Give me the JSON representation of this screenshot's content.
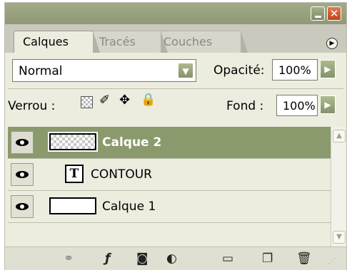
{
  "tabs": [
    {
      "label": "Calques",
      "active": true
    },
    {
      "label": "Tracés",
      "active": false
    },
    {
      "label": "Couches",
      "active": false
    }
  ],
  "panel_menu_icon": "panel-menu-icon",
  "blend": {
    "mode": "Normal",
    "opacity_label": "Opacité:",
    "opacity_value": "100%"
  },
  "lock": {
    "label": "Verrou :",
    "fill_label": "Fond :",
    "fill_value": "100%",
    "icons": [
      "lock-transparency-icon",
      "lock-paint-icon",
      "lock-move-icon",
      "lock-all-icon"
    ]
  },
  "layers": [
    {
      "name": "Calque 2",
      "selected": true,
      "visible": true,
      "thumb": "transparent"
    },
    {
      "name": "CONTOUR",
      "selected": false,
      "visible": true,
      "thumb": "text",
      "thumb_letter": "T"
    },
    {
      "name": "Calque 1",
      "selected": false,
      "visible": true,
      "thumb": "white"
    }
  ],
  "footer_icons": [
    "link-layers-icon",
    "layer-style-icon",
    "mask-icon",
    "adjustment-layer-icon",
    "group-folder-icon",
    "new-layer-icon",
    "trash-icon"
  ],
  "colors": {
    "titlebar": "#969f7e",
    "selected_row": "#8a9a6c",
    "accent_arrow": "#84916a",
    "close_button": "#c04416"
  }
}
